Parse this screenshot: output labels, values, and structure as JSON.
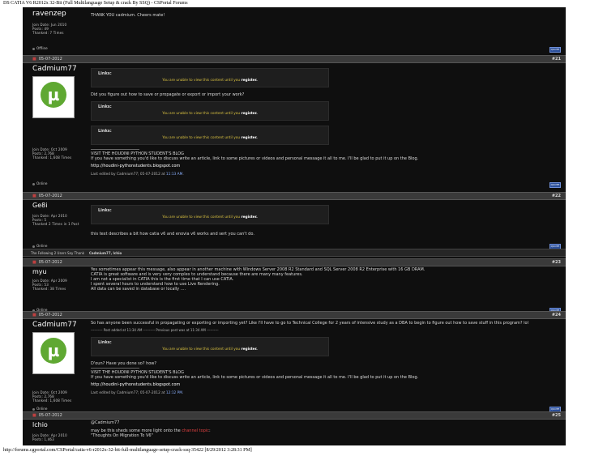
{
  "page": {
    "title": "DS CATIA V6 R2012x 32-Bit (Full Multilanguage Setup & crack By SSQ) - CSPortal Forums",
    "footer": "http://forums.cgportal.com/CSPortal/catia-v6-r2012x-32-bit-full-multilanguage-setup-crack-ssq-35422 [8/29/2012 3:28:31 PM]"
  },
  "icons": {
    "quote": "quote-button-icon",
    "status": "status-dot-icon",
    "avatar": "utorrent-logo"
  },
  "colors": {
    "background": "#0f0f0f",
    "header": "#3a3a3a",
    "notice": "#d8c040",
    "link_highlight": "#e04040"
  },
  "posts": [
    {
      "user": "ravenzep",
      "info": [
        "Join Date: Jun 2010",
        "Posts: 49",
        "Thanked: 7 Times"
      ],
      "status": "Offline",
      "text": "THANK YOU cadmium. Cheers mate!"
    },
    {
      "date": "05-07-2012",
      "number": "#21",
      "user": "Cadmium77",
      "info": [
        "Join Date: Oct 2009",
        "Posts: 2,768",
        "Thanked: 1,608 Times"
      ],
      "status": "Online",
      "links_label": "Links:",
      "notice_pre": "You are unable to view this content until you ",
      "notice_reg": "register.",
      "middle_text": "Did you figure out how to save or propagate or export or import your work?",
      "sig_line1": "VISIT THE HOUDINI PYTHON STUDENT'S BLOG",
      "sig_line2": "If you have something you'd like to discuss write an article, link to some pictures or videos and personal message it all to me. I'll be glad to put it up on the Blog.",
      "sig_link": "http://houdini-pythonstudents.blogspot.com",
      "edited_pre": "Last edited by Cadmium77; 05-07-2012 at ",
      "edited_time": "11:13 AM",
      "edited_post": "."
    },
    {
      "date": "05-07-2012",
      "number": "#22",
      "user": "Ge8i",
      "info": [
        "Join Date: Apr 2010",
        "Posts: 5",
        "Thanked 2 Times in 1 Post"
      ],
      "status": "Online",
      "links_label": "Links:",
      "notice_pre": "You are unable to view this content until you ",
      "notice_reg": "register.",
      "text": "this text describes a bit how catia v6 and enovia v6 works and sert you can't do."
    },
    {
      "thanks_label": "The Following 2 Users Say Thank",
      "thanks_users": "Cadmium77, lchio"
    },
    {
      "date": "05-07-2012",
      "number": "#23",
      "user": "myu",
      "info": [
        "Join Date: Apr 2009",
        "Posts: 53",
        "Thanked: 38 Times"
      ],
      "status": "Online",
      "lines": [
        "Yes sometimes appear this message, also appear in another machine with Windows Server 2008 R2 Standard and SQL Server 2008 R2 Enterprise with 16 GB DRAM.",
        "CATIA is great software and is very very complex to understand because there are many many features.",
        "I am not a specialist in CATIA this is the first time that I can use CATIA.",
        "I spent several hours to understand how to use Live Rendering.",
        "All data can be saved in database or locally ...."
      ]
    },
    {
      "date": "05-07-2012",
      "number": "#24",
      "user": "Cadmium77",
      "info": [
        "Join Date: Oct 2009",
        "Posts: 2,768",
        "Thanked: 1,608 Times"
      ],
      "status": "Online",
      "text": "So has anyone been successful in propagating or exporting or importing yet? Like I'll have to go to Technical College for 2 years of intensive study as a DBA to begin to figure out how to save stuff in this program? lol",
      "merged": "---------- Post added at 11:34 AM ---------- Previous post was at 11:34 AM ----------",
      "links_label": "Links:",
      "notice_pre": "You are unable to view this content until you ",
      "notice_reg": "register.",
      "question": "D'oun? Have you done so? how?",
      "sig_line1": "VISIT THE HOUDINI PYTHON STUDENT'S BLOG",
      "sig_line2": "If you have something you'd like to discuss write an article, link to some pictures or videos and personal message it all to me. I'll be glad to put it up on the Blog.",
      "sig_link": "http://houdini-pythonstudents.blogspot.com",
      "edited_pre": "Last edited by Cadmium77; 05-07-2012 at ",
      "edited_time": "12:12 PM",
      "edited_post": "."
    },
    {
      "date": "05-07-2012",
      "number": "#25",
      "user": "lchio",
      "info": [
        "Join Date: Apr 2010",
        "Posts: 1,463"
      ],
      "text1": "@Cadmium77",
      "text2_pre": "may be this sheds some more light onto the ",
      "text2_link": "channel topic",
      "text2_post": ":",
      "text3": "\"Thoughts On Migration To V6\""
    }
  ]
}
